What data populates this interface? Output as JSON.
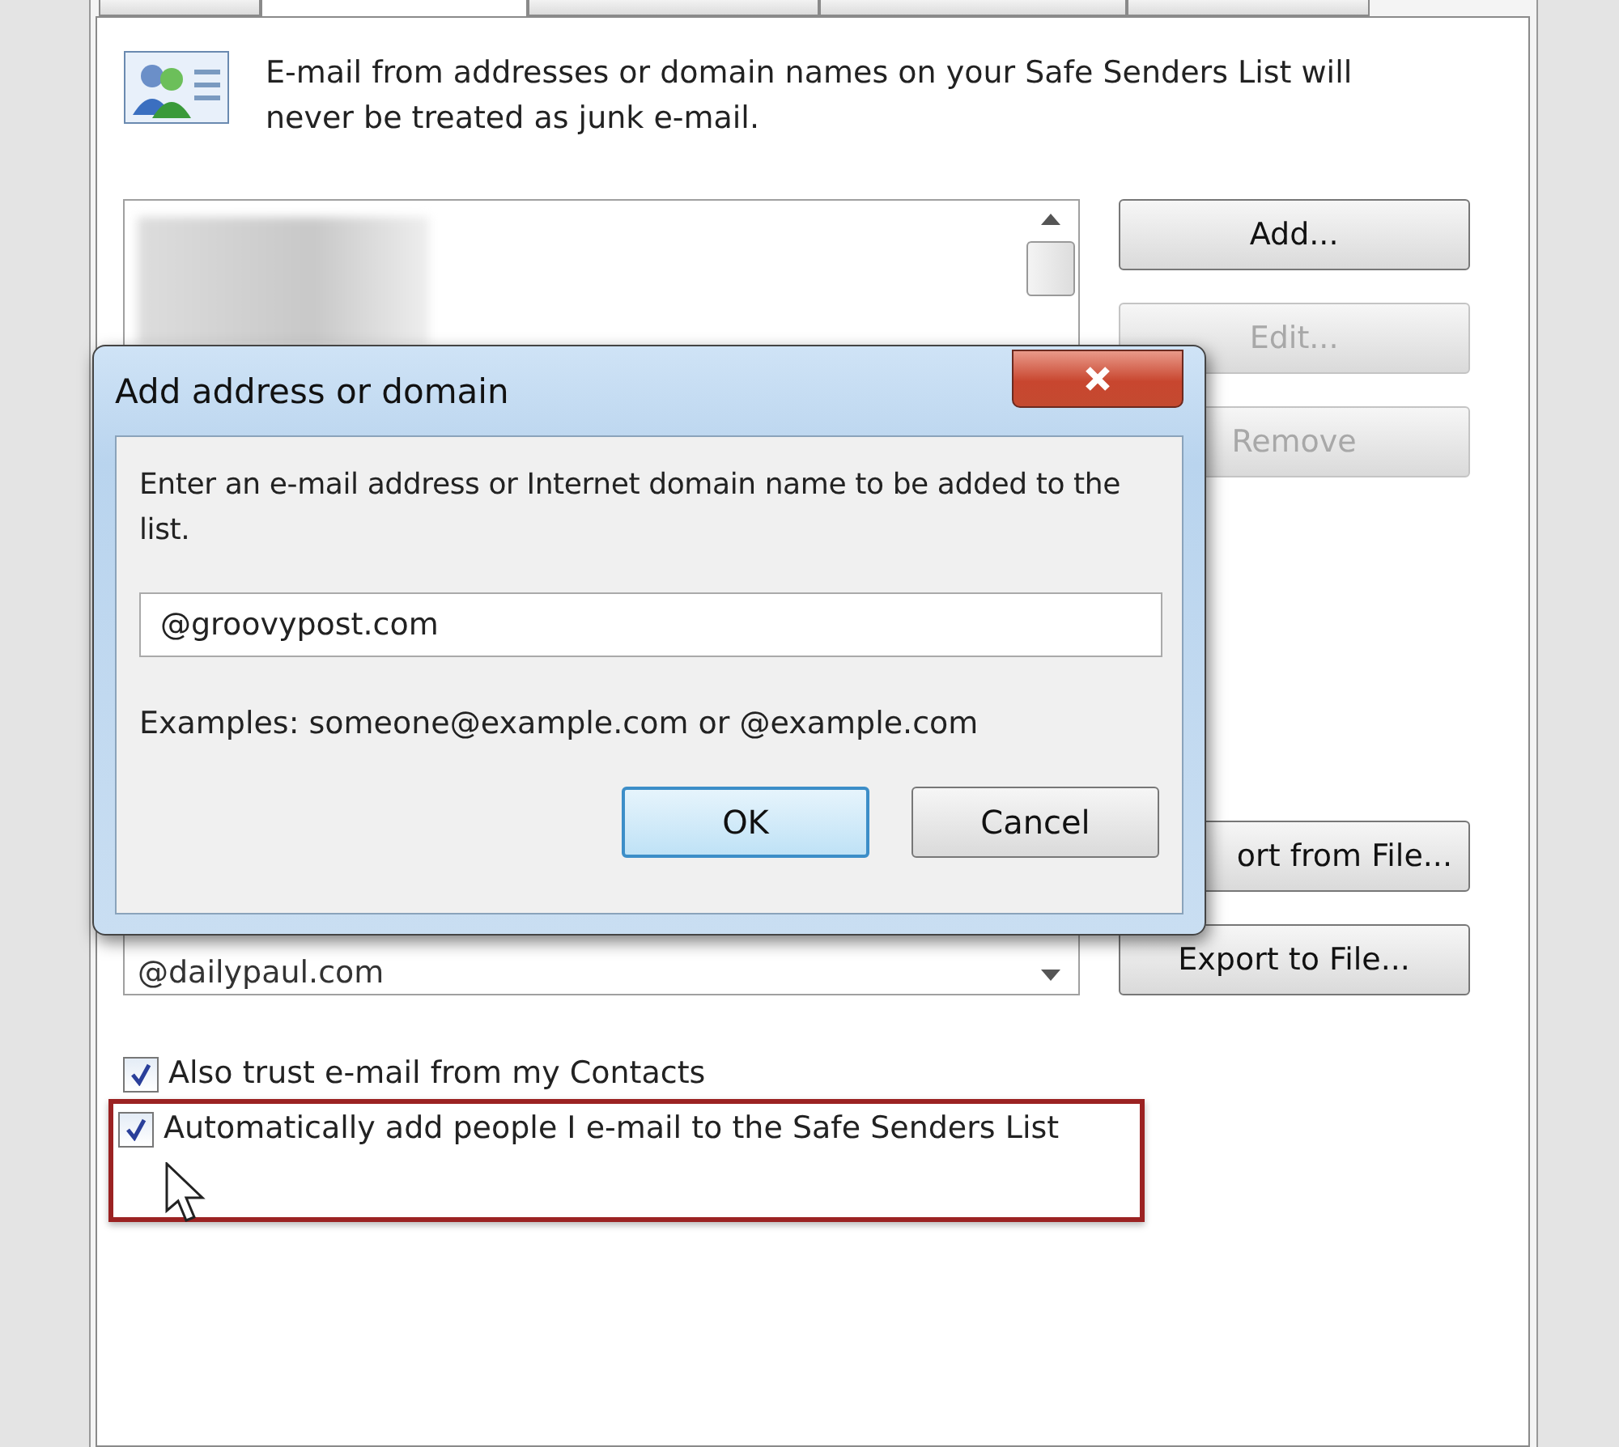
{
  "tabs": [
    {
      "selected": false
    },
    {
      "selected": true
    },
    {
      "selected": false
    },
    {
      "selected": false
    },
    {
      "selected": false
    }
  ],
  "info": {
    "text": "E-mail from addresses or domain names on your Safe Senders List will never be treated as junk e-mail."
  },
  "list": {
    "entries": [
      "@dailypaul.com"
    ]
  },
  "buttons_top": [
    {
      "label": "Add...",
      "disabled": false
    },
    {
      "label": "Edit...",
      "disabled": true
    },
    {
      "label": "Remove",
      "disabled": true
    }
  ],
  "buttons_bottom": [
    {
      "label": "ort from File...",
      "disabled": false
    },
    {
      "label": "Export to File...",
      "disabled": false
    }
  ],
  "options": [
    {
      "label": "Also trust e-mail from my Contacts",
      "checked": true,
      "highlighted": false
    },
    {
      "label": "Automatically add people I e-mail to the Safe Senders List",
      "checked": true,
      "highlighted": true
    }
  ],
  "dialog": {
    "title": "Add address or domain",
    "prompt": "Enter an e-mail address or Internet domain name to be added to the list.",
    "value": "@groovypost.com",
    "examples": "Examples: someone@example.com or @example.com",
    "ok": "OK",
    "cancel": "Cancel"
  }
}
